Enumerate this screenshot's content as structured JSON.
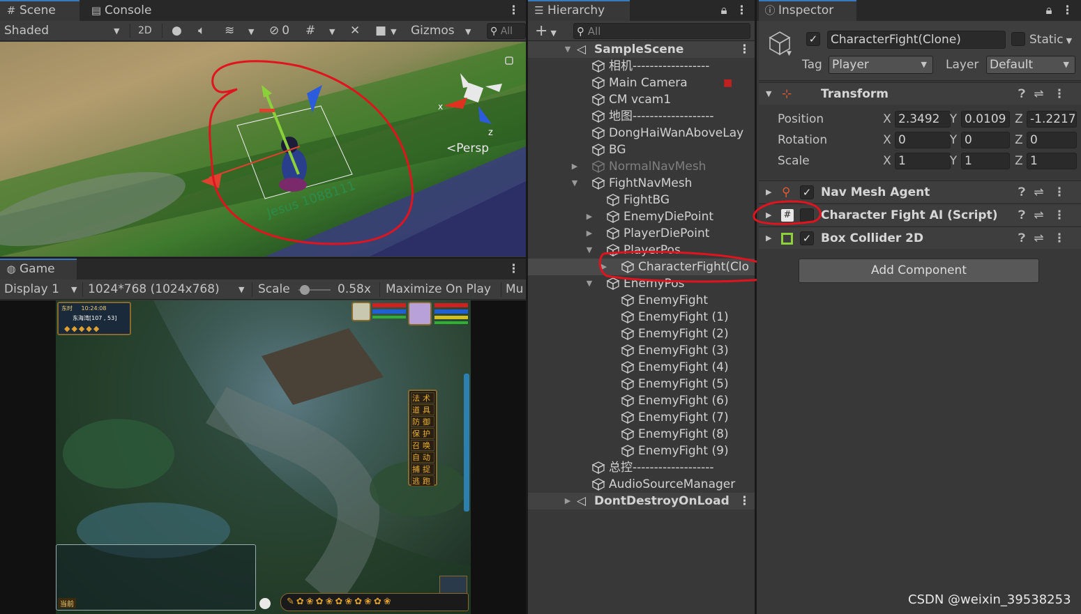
{
  "scene_panel": {
    "tabs": [
      {
        "label": "Scene",
        "icon": "hash-icon"
      },
      {
        "label": "Console",
        "icon": "console-icon"
      }
    ],
    "toolbar": {
      "shading": "Shaded",
      "mode_2d": "2D",
      "hidden_count": "0",
      "gizmos": "Gizmos",
      "search_placeholder": "All"
    },
    "persp_label": "Persp",
    "axis_labels": {
      "x": "x",
      "z": "z"
    },
    "ground_text": "Jesus 1088111"
  },
  "game_panel": {
    "tab": "Game",
    "display": "Display 1",
    "resolution": "1024*768 (1024x768)",
    "scale_label": "Scale",
    "scale_value": "0.58x",
    "maximize": "Maximize On Play",
    "mute": "Mu",
    "hud": {
      "time_label": "东时",
      "clock": "10:24:08",
      "map_name": "东海湾[107 , 53]",
      "menu": [
        "法术",
        "道具",
        "防御",
        "保护",
        "召唤",
        "自动",
        "捕捉",
        "逃跑"
      ],
      "chat_label": "当前"
    }
  },
  "hierarchy": {
    "tab": "Hierarchy",
    "search_placeholder": "All",
    "rows": [
      {
        "label": "SampleScene",
        "indent": 0,
        "arrow": "▼",
        "scene": true
      },
      {
        "label": "相机------------------",
        "indent": 1
      },
      {
        "label": "Main Camera",
        "indent": 1
      },
      {
        "label": "CM vcam1",
        "indent": 1
      },
      {
        "label": "地图-------------------",
        "indent": 1
      },
      {
        "label": "DongHaiWanAboveLay",
        "indent": 1
      },
      {
        "label": "BG",
        "indent": 1
      },
      {
        "label": "NormalNavMesh",
        "indent": 1,
        "arrow": "▶",
        "dim": true
      },
      {
        "label": "FightNavMesh",
        "indent": 1,
        "arrow": "▼"
      },
      {
        "label": "FightBG",
        "indent": 2
      },
      {
        "label": "EnemyDiePoint",
        "indent": 2,
        "arrow": "▶"
      },
      {
        "label": "PlayerDiePoint",
        "indent": 2,
        "arrow": "▶"
      },
      {
        "label": "PlayerPos",
        "indent": 2,
        "arrow": "▼"
      },
      {
        "label": "CharacterFight(Clo",
        "indent": 3,
        "arrow": "▶",
        "selected": true
      },
      {
        "label": "EnemyPos",
        "indent": 2,
        "arrow": "▼"
      },
      {
        "label": "EnemyFight",
        "indent": 3
      },
      {
        "label": "EnemyFight (1)",
        "indent": 3
      },
      {
        "label": "EnemyFight (2)",
        "indent": 3
      },
      {
        "label": "EnemyFight (3)",
        "indent": 3
      },
      {
        "label": "EnemyFight (4)",
        "indent": 3
      },
      {
        "label": "EnemyFight (5)",
        "indent": 3
      },
      {
        "label": "EnemyFight (6)",
        "indent": 3
      },
      {
        "label": "EnemyFight (7)",
        "indent": 3
      },
      {
        "label": "EnemyFight (8)",
        "indent": 3
      },
      {
        "label": "EnemyFight (9)",
        "indent": 3
      },
      {
        "label": "总控-------------------",
        "indent": 1
      },
      {
        "label": "AudioSourceManager",
        "indent": 1
      },
      {
        "label": "DontDestroyOnLoad",
        "indent": 0,
        "arrow": "▶",
        "scene": true
      }
    ]
  },
  "inspector": {
    "tab": "Inspector",
    "object_name": "CharacterFight(Clone)",
    "static_label": "Static",
    "tag_label": "Tag",
    "tag_value": "Player",
    "layer_label": "Layer",
    "layer_value": "Default",
    "transform": {
      "title": "Transform",
      "position_label": "Position",
      "rotation_label": "Rotation",
      "scale_label": "Scale",
      "position": {
        "x": "2.3492",
        "y": "0.0109",
        "z": "-1.2217"
      },
      "rotation": {
        "x": "0",
        "y": "0",
        "z": "0"
      },
      "scale": {
        "x": "1",
        "y": "1",
        "z": "1"
      }
    },
    "components": [
      {
        "title": "Nav Mesh Agent",
        "enabled": true
      },
      {
        "title": "Character Fight AI (Script)",
        "enabled": false
      },
      {
        "title": "Box Collider 2D",
        "enabled": true
      }
    ],
    "add_component": "Add Component",
    "watermark": "CSDN @weixin_39538253"
  },
  "colors": {
    "accent": "#3a79bb",
    "annotation": "#e0141e",
    "panel": "#383838"
  }
}
